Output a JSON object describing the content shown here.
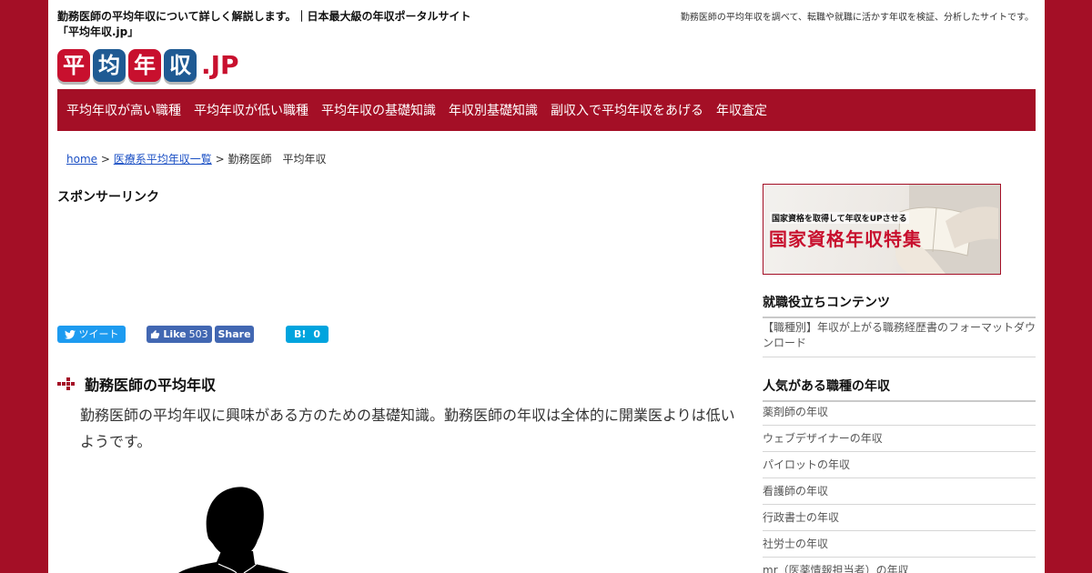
{
  "header": {
    "site_title": "勤務医師の平均年収について詳しく解説します。｜日本最大級の年収ポータルサイト「平均年収.jp」",
    "description": "勤務医師の平均年収を調べて、転職や就職に活かす年収を検証、分析したサイトです。",
    "logo": {
      "chars": [
        "平",
        "均",
        "年",
        "収"
      ],
      "suffix": ".JP"
    }
  },
  "nav": {
    "items": [
      "平均年収が高い職種",
      "平均年収が低い職種",
      "平均年収の基礎知識",
      "年収別基礎知識",
      "副収入で平均年収をあげる",
      "年収査定"
    ]
  },
  "breadcrumb": {
    "home": "home",
    "sep1": ">",
    "category": "医療系平均年収一覧",
    "sep2": ">",
    "current": "勤務医師　平均年収"
  },
  "main": {
    "sponsor_label": "スポンサーリンク",
    "share": {
      "tweet": "ツイート",
      "fb_like": "Like",
      "fb_like_count": "503",
      "fb_share": "Share",
      "hatena_label": "B!",
      "hatena_count": "0"
    },
    "section_title": "勤務医師の平均年収",
    "intro": "勤務医師の平均年収に興味がある方のための基礎知識。勤務医師の年収は全体的に開業医よりは低いようです。"
  },
  "sidebar": {
    "banner": {
      "subtitle": "国家資格を取得して年収をUPさせる",
      "title": "国家資格年収特集"
    },
    "useful_heading": "就職役立ちコンテンツ",
    "useful_items": [
      "【職種別】年収が上がる職務経歴書のフォーマットダウンロード"
    ],
    "popular_heading": "人気がある職種の年収",
    "popular_items": [
      "薬剤師の年収",
      "ウェブデザイナーの年収",
      "パイロットの年収",
      "看護師の年収",
      "行政書士の年収",
      "社労士の年収",
      "mr（医薬情報担当者）の年収"
    ]
  },
  "colors": {
    "brand_red": "#a40f26",
    "logo_red": "#c8102e",
    "logo_blue": "#1f5a93",
    "link_blue": "#1a4fc4",
    "twitter": "#1d9bf0",
    "facebook": "#4267b2",
    "hatena": "#00a4de"
  }
}
